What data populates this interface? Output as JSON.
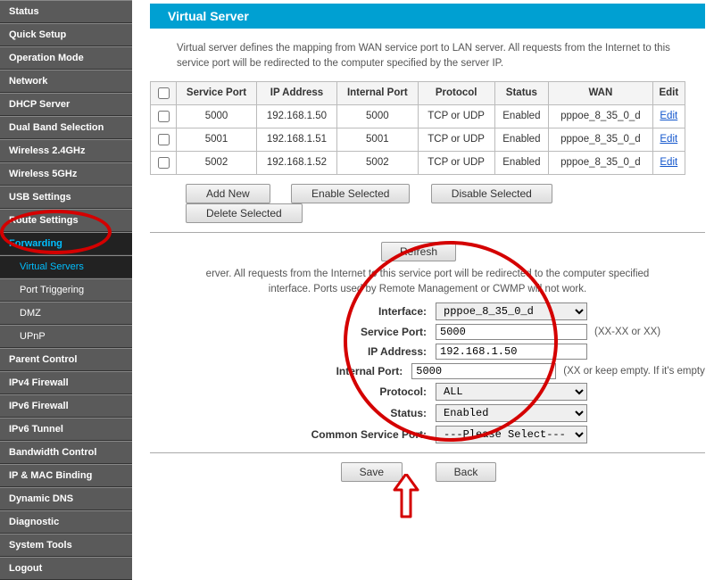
{
  "sidebar": {
    "items": [
      {
        "label": "Status"
      },
      {
        "label": "Quick Setup"
      },
      {
        "label": "Operation Mode"
      },
      {
        "label": "Network"
      },
      {
        "label": "DHCP Server"
      },
      {
        "label": "Dual Band Selection"
      },
      {
        "label": "Wireless 2.4GHz"
      },
      {
        "label": "Wireless 5GHz"
      },
      {
        "label": "USB Settings"
      },
      {
        "label": "Route Settings"
      },
      {
        "label": "Forwarding"
      },
      {
        "label": "Virtual Servers"
      },
      {
        "label": "Port Triggering"
      },
      {
        "label": "DMZ"
      },
      {
        "label": "UPnP"
      },
      {
        "label": "Parent Control"
      },
      {
        "label": "IPv4 Firewall"
      },
      {
        "label": "IPv6 Firewall"
      },
      {
        "label": "IPv6 Tunnel"
      },
      {
        "label": "Bandwidth Control"
      },
      {
        "label": "IP & MAC Binding"
      },
      {
        "label": "Dynamic DNS"
      },
      {
        "label": "Diagnostic"
      },
      {
        "label": "System Tools"
      },
      {
        "label": "Logout"
      }
    ]
  },
  "page": {
    "title": "Virtual Server",
    "description": "Virtual server defines the mapping from WAN service port to LAN server. All requests from the Internet to this service port will be redirected to the computer specified by the server IP."
  },
  "table": {
    "headers": {
      "service_port": "Service Port",
      "ip_address": "IP Address",
      "internal_port": "Internal Port",
      "protocol": "Protocol",
      "status": "Status",
      "wan": "WAN",
      "edit": "Edit"
    },
    "rows": [
      {
        "service_port": "5000",
        "ip": "192.168.1.50",
        "internal_port": "5000",
        "protocol": "TCP or UDP",
        "status": "Enabled",
        "wan": "pppoe_8_35_0_d",
        "edit": "Edit"
      },
      {
        "service_port": "5001",
        "ip": "192.168.1.51",
        "internal_port": "5001",
        "protocol": "TCP or UDP",
        "status": "Enabled",
        "wan": "pppoe_8_35_0_d",
        "edit": "Edit"
      },
      {
        "service_port": "5002",
        "ip": "192.168.1.52",
        "internal_port": "5002",
        "protocol": "TCP or UDP",
        "status": "Enabled",
        "wan": "pppoe_8_35_0_d",
        "edit": "Edit"
      }
    ]
  },
  "buttons": {
    "add_new": "Add New",
    "enable_selected": "Enable Selected",
    "disable_selected": "Disable Selected",
    "delete_selected": "Delete Selected",
    "refresh": "Refresh",
    "save": "Save",
    "back": "Back"
  },
  "form": {
    "help": "erver. All requests from the Internet to this service port will be redirected to the computer specified interface. Ports used by Remote Management or CWMP will not work.",
    "labels": {
      "interface": "Interface:",
      "service_port": "Service Port:",
      "ip_address": "IP Address:",
      "internal_port": "Internal Port:",
      "protocol": "Protocol:",
      "status": "Status:",
      "common_service_port": "Common Service Port:"
    },
    "values": {
      "interface": "pppoe_8_35_0_d",
      "service_port": "5000",
      "ip_address": "192.168.1.50",
      "internal_port": "5000",
      "protocol": "ALL",
      "status": "Enabled",
      "common_service_port": "---Please Select---"
    },
    "hints": {
      "service_port": "(XX-XX or XX)",
      "internal_port": "(XX or keep empty. If it's empty, In"
    }
  }
}
